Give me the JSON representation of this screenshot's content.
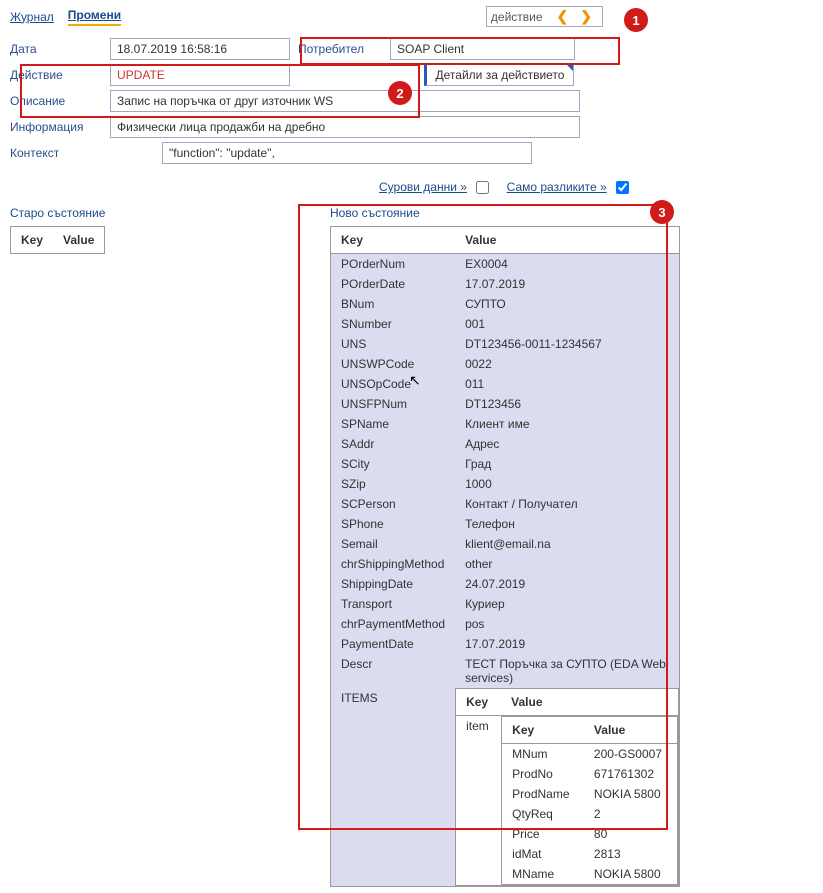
{
  "tabs": {
    "journal": "Журнал",
    "changes": "Промени"
  },
  "nav": {
    "label": "действие",
    "prev": "❮",
    "next": "❯"
  },
  "labels": {
    "date": "Дата",
    "action": "Действие",
    "user": "Потребител",
    "details": "Детайли за действието",
    "desc": "Описание",
    "info": "Информация",
    "ctx": "Контекст"
  },
  "fields": {
    "date": "18.07.2019 16:58:16",
    "action": "UPDATE",
    "user": "SOAP Client",
    "details": "Детайли за действието",
    "desc": "Запис на поръчка от друг източник WS",
    "info": "Физически лица продажби на дребно",
    "ctx": "\"function\": \"update\","
  },
  "toggles": {
    "raw": "Сурови данни »",
    "diff": "Само разликите »",
    "raw_checked": false,
    "diff_checked": true
  },
  "markers": {
    "m1": "1",
    "m2": "2",
    "m3": "3"
  },
  "old_state": {
    "title": "Старо състояние",
    "key": "Key",
    "value": "Value"
  },
  "new_state": {
    "title": "Ново състояние",
    "key": "Key",
    "value": "Value",
    "rows": [
      {
        "k": "POrderNum",
        "v": "EX0004"
      },
      {
        "k": "POrderDate",
        "v": "17.07.2019"
      },
      {
        "k": "BNum",
        "v": "СУПТО"
      },
      {
        "k": "SNumber",
        "v": "001"
      },
      {
        "k": "UNS",
        "v": "DT123456-0011-1234567"
      },
      {
        "k": "UNSWPCode",
        "v": "0022"
      },
      {
        "k": "UNSOpCode",
        "v": "011"
      },
      {
        "k": "UNSFPNum",
        "v": "DT123456"
      },
      {
        "k": "SPName",
        "v": "Клиент име"
      },
      {
        "k": "SAddr",
        "v": "Адрес"
      },
      {
        "k": "SCity",
        "v": "Град"
      },
      {
        "k": "SZip",
        "v": "1000"
      },
      {
        "k": "SCPerson",
        "v": "Контакт / Получател"
      },
      {
        "k": "SPhone",
        "v": "Телефон"
      },
      {
        "k": "Semail",
        "v": "klient@email.na"
      },
      {
        "k": "chrShippingMethod",
        "v": "other"
      },
      {
        "k": "ShippingDate",
        "v": "24.07.2019"
      },
      {
        "k": "Transport",
        "v": "Куриер"
      },
      {
        "k": "chrPaymentMethod",
        "v": "pos"
      },
      {
        "k": "PaymentDate",
        "v": "17.07.2019"
      },
      {
        "k": "Descr",
        "v": "ТЕСТ Поръчка за СУПТО (EDA Web services)"
      }
    ],
    "items_key": "ITEMS",
    "items_inner": {
      "key": "Key",
      "value": "Value",
      "item_label": "item",
      "detail": {
        "key": "Key",
        "value": "Value",
        "rows": [
          {
            "k": "MNum",
            "v": "200-GS0007"
          },
          {
            "k": "ProdNo",
            "v": "671761302"
          },
          {
            "k": "ProdName",
            "v": "NOKIA 5800"
          },
          {
            "k": "QtyReq",
            "v": "2"
          },
          {
            "k": "Price",
            "v": "80"
          },
          {
            "k": "idMat",
            "v": "2813"
          },
          {
            "k": "MName",
            "v": "NOKIA 5800"
          }
        ]
      }
    }
  }
}
